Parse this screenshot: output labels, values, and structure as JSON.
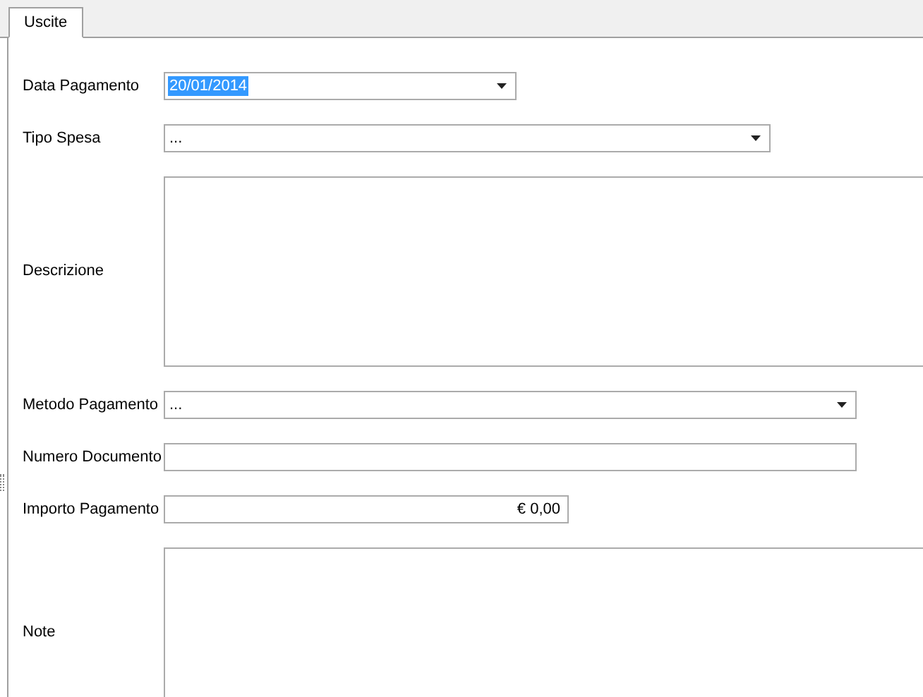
{
  "tabs": [
    {
      "label": "Uscite",
      "selected": true
    }
  ],
  "fields": [
    {
      "kind": "combo",
      "label": "Data Pagamento",
      "value": "20/01/2014",
      "value_selected": true
    },
    {
      "kind": "combo",
      "label": "Tipo Spesa",
      "value": "...",
      "value_selected": false
    },
    {
      "kind": "memo",
      "label": "Descrizione"
    },
    {
      "kind": "combo",
      "label": "Metodo Pagamento",
      "value": "...",
      "value_selected": false
    },
    {
      "kind": "text",
      "label": "Numero Documento"
    },
    {
      "kind": "number",
      "label": "Importo Pagamento",
      "value": "€ 0,00",
      "value_selected": false
    },
    {
      "kind": "memo",
      "label": "Note"
    }
  ]
}
